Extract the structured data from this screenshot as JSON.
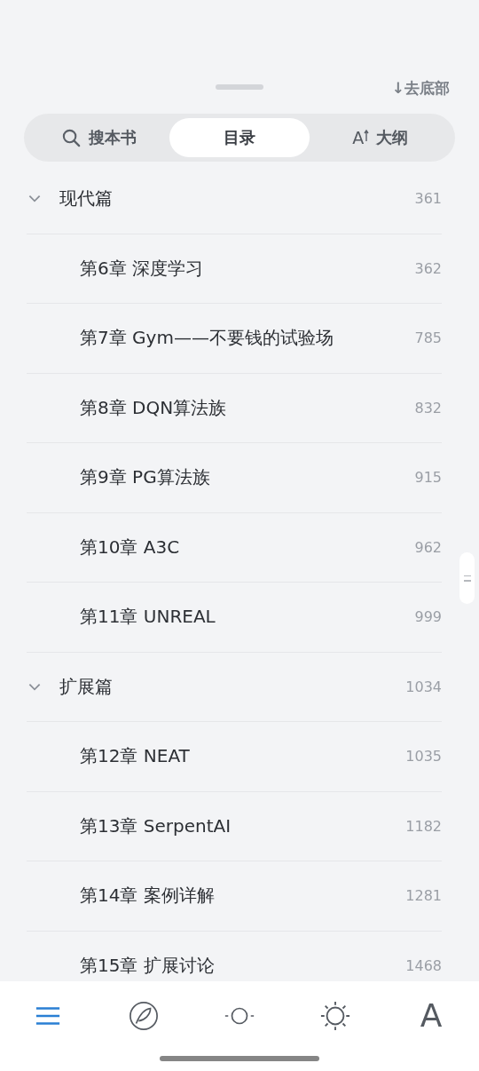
{
  "sheet": {
    "jump_link": "↓去底部"
  },
  "tabs": [
    {
      "kind": "search",
      "label": "搜本书",
      "selected": false
    },
    {
      "kind": "plain",
      "label": "目录",
      "selected": true
    },
    {
      "kind": "ai",
      "icon_text": "A",
      "label": "大纲",
      "selected": false
    }
  ],
  "toc": [
    {
      "title": "现代篇",
      "page": "361",
      "expanded": true,
      "children": [
        {
          "title": "第6章 深度学习",
          "page": "362"
        },
        {
          "title": "第7章 Gym——不要钱的试验场",
          "page": "785"
        },
        {
          "title": "第8章 DQN算法族",
          "page": "832"
        },
        {
          "title": "第9章 PG算法族",
          "page": "915"
        },
        {
          "title": "第10章 A3C",
          "page": "962"
        },
        {
          "title": "第11章 UNREAL",
          "page": "999"
        }
      ]
    },
    {
      "title": "扩展篇",
      "page": "1034",
      "expanded": true,
      "children": [
        {
          "title": "第12章 NEAT",
          "page": "1035"
        },
        {
          "title": "第13章 SerpentAI",
          "page": "1182"
        },
        {
          "title": "第14章 案例详解",
          "page": "1281"
        },
        {
          "title": "第15章 扩展讨论",
          "page": "1468"
        }
      ]
    }
  ],
  "bottom_nav": [
    {
      "kind": "menu",
      "selected": true
    },
    {
      "kind": "compass",
      "selected": false
    },
    {
      "kind": "progress",
      "selected": false
    },
    {
      "kind": "brightness",
      "selected": false
    },
    {
      "kind": "font",
      "label": "A",
      "selected": false
    }
  ]
}
